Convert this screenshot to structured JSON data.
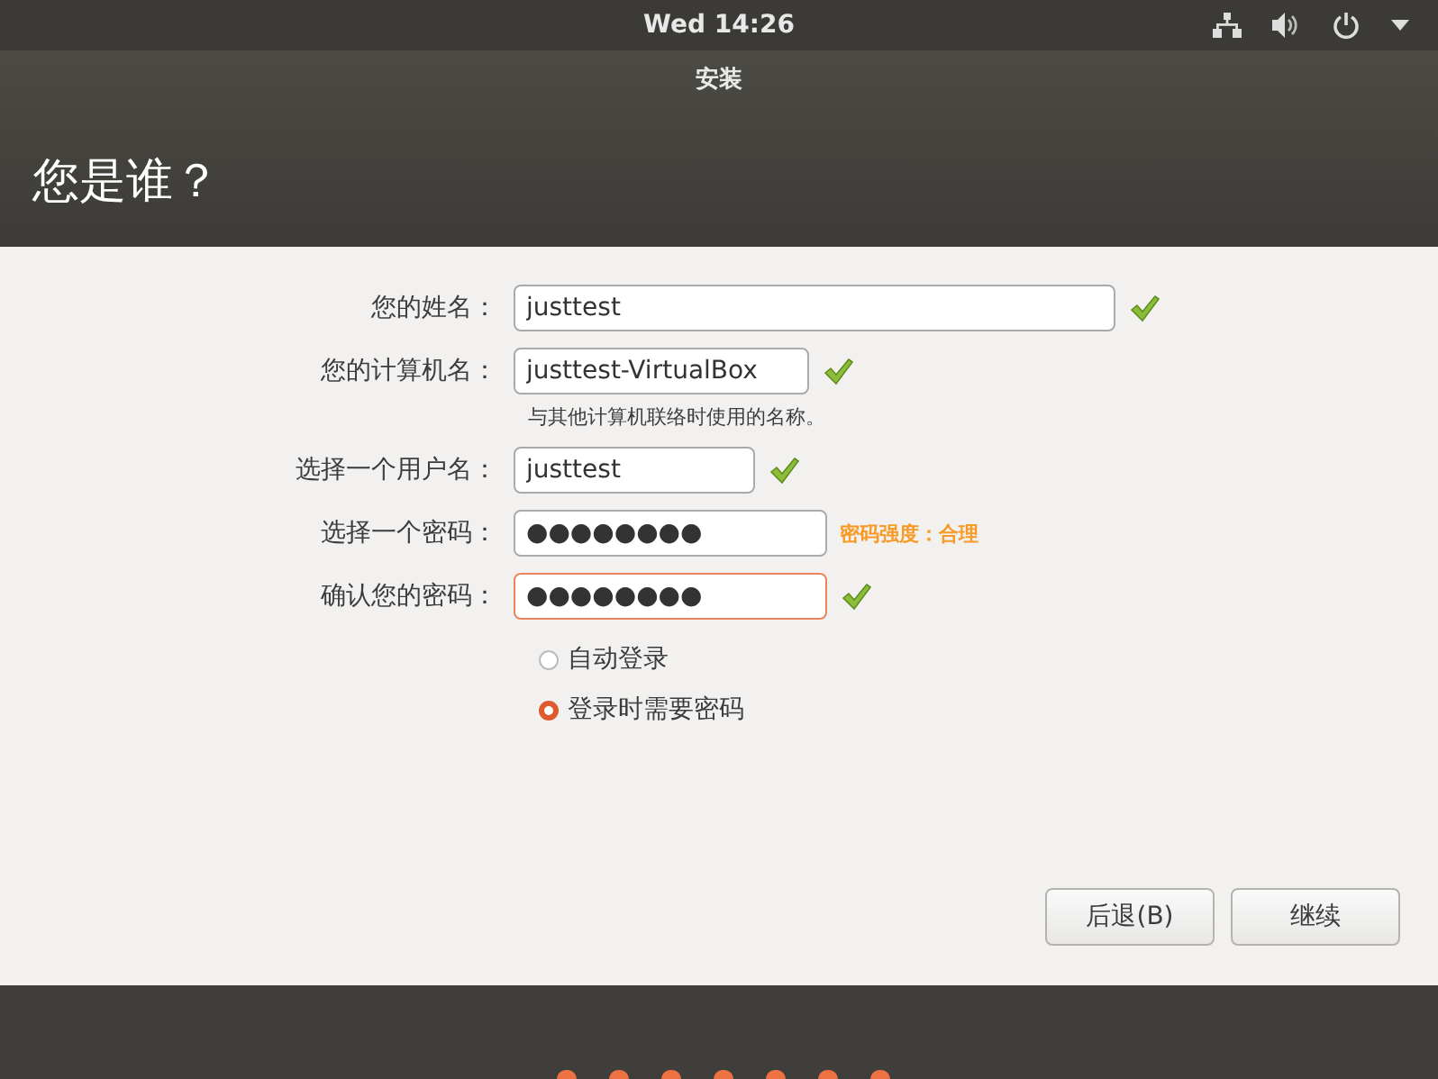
{
  "top_bar": {
    "clock": "Wed 14:26"
  },
  "window": {
    "title": "安装"
  },
  "page_title": "您是谁？",
  "fields": [
    {
      "label": "您的姓名：",
      "value": "justtest",
      "valid": true,
      "focused": false
    },
    {
      "label": "您的计算机名：",
      "value": "justtest-VirtualBox",
      "valid": true,
      "focused": false,
      "hint": "与其他计算机联络时使用的名称。"
    },
    {
      "label": "选择一个用户名：",
      "value": "justtest",
      "valid": true,
      "focused": false
    },
    {
      "label": "选择一个密码：",
      "value": "●●●●●●●●",
      "valid": false,
      "focused": false,
      "strength": "密码强度：合理"
    },
    {
      "label": "确认您的密码：",
      "value": "●●●●●●●●",
      "valid": true,
      "focused": true
    }
  ],
  "login_options": [
    {
      "label": "自动登录",
      "selected": false
    },
    {
      "label": "登录时需要密码",
      "selected": true
    }
  ],
  "buttons": [
    "后退(B)",
    "继续"
  ],
  "progress_steps": [
    {
      "done": true
    },
    {
      "done": true
    },
    {
      "done": true
    },
    {
      "done": true
    },
    {
      "done": true
    },
    {
      "done": true
    },
    {
      "done": true
    }
  ]
}
